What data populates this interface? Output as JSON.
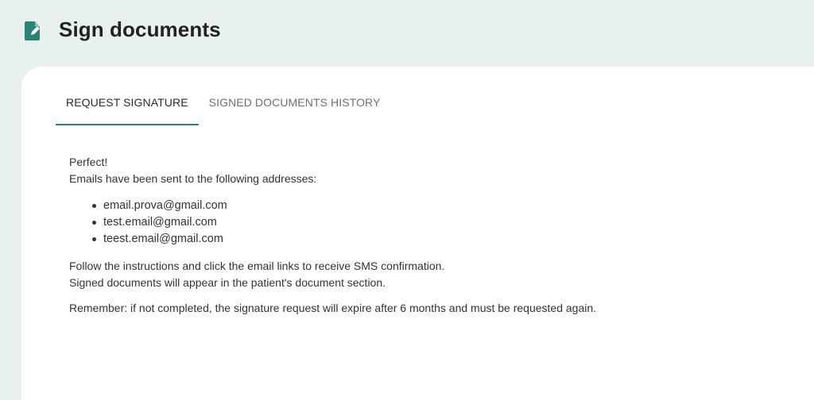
{
  "header": {
    "title": "Sign documents",
    "icon": "sign-document-icon",
    "icon_color": "#268479"
  },
  "tabs": [
    {
      "label": "REQUEST SIGNATURE",
      "active": true
    },
    {
      "label": "SIGNED DOCUMENTS HISTORY",
      "active": false
    }
  ],
  "content": {
    "success_heading": "Perfect!",
    "emails_intro": "Emails have been sent to the following addresses:",
    "emails": [
      "email.prova@gmail.com",
      "test.email@gmail.com",
      "teest.email@gmail.com"
    ],
    "instructions_line1": "Follow the instructions and click the email links to receive SMS confirmation.",
    "instructions_line2": "Signed documents will appear in the patient's document section.",
    "reminder": "Remember: if not completed, the signature request will expire after 6 months and must be requested again."
  },
  "colors": {
    "background": "#e8f1ee",
    "accent": "#268479",
    "card": "#ffffff"
  }
}
